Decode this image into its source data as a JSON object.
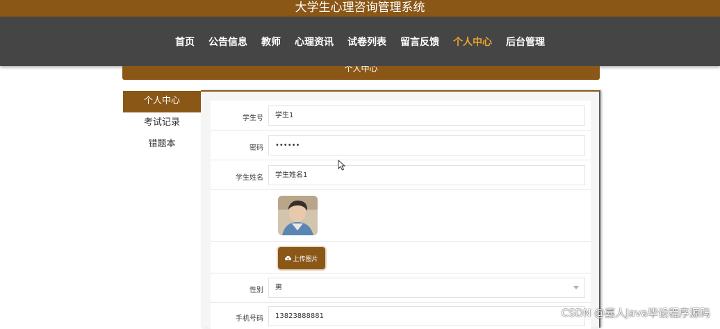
{
  "app": {
    "title": "大学生心理咨询管理系统"
  },
  "nav": {
    "items": [
      {
        "label": "首页"
      },
      {
        "label": "公告信息"
      },
      {
        "label": "教师"
      },
      {
        "label": "心理资讯"
      },
      {
        "label": "试卷列表"
      },
      {
        "label": "留言反馈"
      },
      {
        "label": "个人中心"
      },
      {
        "label": "后台管理"
      }
    ],
    "active_index": 6,
    "active_color": "#e9a42c"
  },
  "section": {
    "title": "个人中心"
  },
  "sidebar": {
    "items": [
      {
        "label": "个人中心"
      },
      {
        "label": "考试记录"
      },
      {
        "label": "错题本"
      }
    ],
    "active_index": 0
  },
  "form": {
    "student_id": {
      "label": "学生号",
      "value": "学生1"
    },
    "password": {
      "label": "密码",
      "value": "••••••"
    },
    "student_name": {
      "label": "学生姓名",
      "value": "学生姓名1"
    },
    "upload_label": "上传图片",
    "gender": {
      "label": "性别",
      "value": "男"
    },
    "phone": {
      "label": "手机号码",
      "value": "13823888881"
    }
  },
  "icons": {
    "upload": "cloud-upload-icon",
    "select": "chevron-down-icon",
    "cursor": "mouse-pointer-icon"
  },
  "colors": {
    "brand": "#8a5717",
    "nav_bg": "#454545",
    "accent": "#e9a42c"
  },
  "watermark": "CSDN @嘉人Java毕设程序源码"
}
